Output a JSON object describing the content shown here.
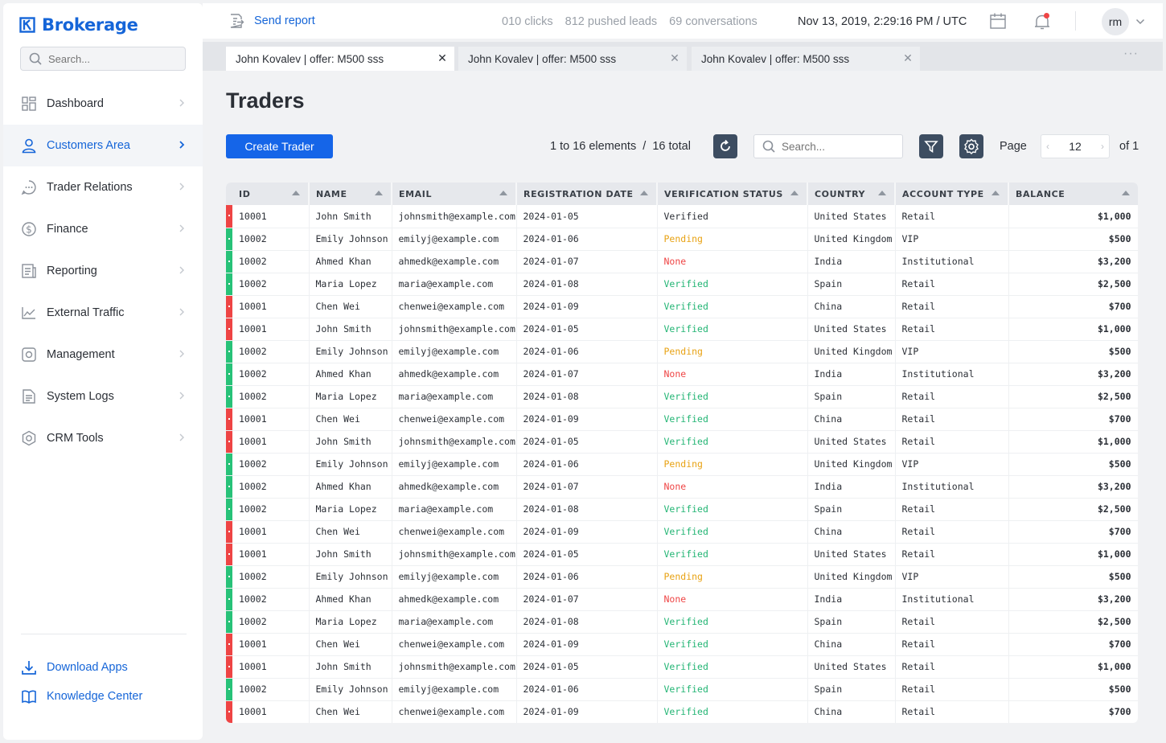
{
  "brand": {
    "name": "Brokerage"
  },
  "sidebar": {
    "search_placeholder": "Search...",
    "items": [
      {
        "label": "Dashboard",
        "icon": "dashboard-icon"
      },
      {
        "label": "Customers Area",
        "icon": "user-icon",
        "active": true
      },
      {
        "label": "Trader Relations",
        "icon": "chat-icon"
      },
      {
        "label": "Finance",
        "icon": "dollar-icon"
      },
      {
        "label": "Reporting",
        "icon": "report-icon"
      },
      {
        "label": "External Traffic",
        "icon": "chart-line-icon"
      },
      {
        "label": "Management",
        "icon": "gear-icon"
      },
      {
        "label": "System Logs",
        "icon": "document-icon"
      },
      {
        "label": "CRM Tools",
        "icon": "cog-icon"
      }
    ],
    "download_apps": "Download Apps",
    "knowledge_center": "Knowledge Center"
  },
  "header": {
    "send_report": "Send report",
    "clicks": "010 clicks",
    "pushed_leads": "812 pushed leads",
    "conversations": "69 conversations",
    "datetime": "Nov 13, 2019, 2:29:16 PM / UTC",
    "avatar_initials": "rm"
  },
  "tabs": [
    {
      "label": "John Kovalev | offer: M500 sss"
    },
    {
      "label": "John Kovalev | offer: M500 sss"
    },
    {
      "label": "John Kovalev | offer: M500 sss"
    }
  ],
  "page": {
    "title": "Traders",
    "create_button": "Create Trader",
    "elements_info": "1 to 16 elements  /  16 total",
    "search_placeholder": "Search...",
    "page_label": "Page",
    "page_number": "12",
    "of_label": "of 1"
  },
  "colors": {
    "accent": "#1565d8",
    "verified": "#23b574",
    "pending": "#e8a213",
    "none": "#ef4545",
    "indicator_red": "#ee4444",
    "indicator_green": "#27c278"
  },
  "table": {
    "columns": [
      "ID",
      "NAME",
      "EMAIL",
      "REGISTRATION DATE",
      "VERIFICATION STATUS",
      "COUNTRY",
      "ACCOUNT TYPE",
      "BALANCE"
    ],
    "rows": [
      {
        "ind": "red",
        "id": "10001",
        "name": "John Smith",
        "email": "johnsmith@example.com",
        "date": "2024-01-05",
        "status": "Verified",
        "status_class": "st-verified-plain",
        "country": "United States",
        "type": "Retail",
        "balance": "$1,000"
      },
      {
        "ind": "green",
        "id": "10002",
        "name": "Emily Johnson",
        "email": "emilyj@example.com",
        "date": "2024-01-06",
        "status": "Pending",
        "status_class": "st-pending",
        "country": "United Kingdom",
        "type": "VIP",
        "balance": "$500"
      },
      {
        "ind": "green",
        "id": "10002",
        "name": "Ahmed Khan",
        "email": "ahmedk@example.com",
        "date": "2024-01-07",
        "status": "None",
        "status_class": "st-none",
        "country": "India",
        "type": "Institutional",
        "balance": "$3,200"
      },
      {
        "ind": "green",
        "id": "10002",
        "name": "Maria Lopez",
        "email": "maria@example.com",
        "date": "2024-01-08",
        "status": "Verified",
        "status_class": "st-verified",
        "country": "Spain",
        "type": "Retail",
        "balance": "$2,500"
      },
      {
        "ind": "red",
        "id": "10001",
        "name": "Chen Wei",
        "email": "chenwei@example.com",
        "date": "2024-01-09",
        "status": "Verified",
        "status_class": "st-verified",
        "country": "China",
        "type": "Retail",
        "balance": "$700"
      },
      {
        "ind": "red",
        "id": "10001",
        "name": "John Smith",
        "email": "johnsmith@example.com",
        "date": "2024-01-05",
        "status": "Verified",
        "status_class": "st-verified",
        "country": "United States",
        "type": "Retail",
        "balance": "$1,000"
      },
      {
        "ind": "green",
        "id": "10002",
        "name": "Emily Johnson",
        "email": "emilyj@example.com",
        "date": "2024-01-06",
        "status": "Pending",
        "status_class": "st-pending",
        "country": "United Kingdom",
        "type": "VIP",
        "balance": "$500"
      },
      {
        "ind": "green",
        "id": "10002",
        "name": "Ahmed Khan",
        "email": "ahmedk@example.com",
        "date": "2024-01-07",
        "status": "None",
        "status_class": "st-none",
        "country": "India",
        "type": "Institutional",
        "balance": "$3,200"
      },
      {
        "ind": "green",
        "id": "10002",
        "name": "Maria Lopez",
        "email": "maria@example.com",
        "date": "2024-01-08",
        "status": "Verified",
        "status_class": "st-verified",
        "country": "Spain",
        "type": "Retail",
        "balance": "$2,500"
      },
      {
        "ind": "red",
        "id": "10001",
        "name": "Chen Wei",
        "email": "chenwei@example.com",
        "date": "2024-01-09",
        "status": "Verified",
        "status_class": "st-verified",
        "country": "China",
        "type": "Retail",
        "balance": "$700"
      },
      {
        "ind": "red",
        "id": "10001",
        "name": "John Smith",
        "email": "johnsmith@example.com",
        "date": "2024-01-05",
        "status": "Verified",
        "status_class": "st-verified",
        "country": "United States",
        "type": "Retail",
        "balance": "$1,000"
      },
      {
        "ind": "green",
        "id": "10002",
        "name": "Emily Johnson",
        "email": "emilyj@example.com",
        "date": "2024-01-06",
        "status": "Pending",
        "status_class": "st-pending",
        "country": "United Kingdom",
        "type": "VIP",
        "balance": "$500"
      },
      {
        "ind": "green",
        "id": "10002",
        "name": "Ahmed Khan",
        "email": "ahmedk@example.com",
        "date": "2024-01-07",
        "status": "None",
        "status_class": "st-none",
        "country": "India",
        "type": "Institutional",
        "balance": "$3,200"
      },
      {
        "ind": "green",
        "id": "10002",
        "name": "Maria Lopez",
        "email": "maria@example.com",
        "date": "2024-01-08",
        "status": "Verified",
        "status_class": "st-verified",
        "country": "Spain",
        "type": "Retail",
        "balance": "$2,500"
      },
      {
        "ind": "red",
        "id": "10001",
        "name": "Chen Wei",
        "email": "chenwei@example.com",
        "date": "2024-01-09",
        "status": "Verified",
        "status_class": "st-verified",
        "country": "China",
        "type": "Retail",
        "balance": "$700"
      },
      {
        "ind": "red",
        "id": "10001",
        "name": "John Smith",
        "email": "johnsmith@example.com",
        "date": "2024-01-05",
        "status": "Verified",
        "status_class": "st-verified",
        "country": "United States",
        "type": "Retail",
        "balance": "$1,000"
      },
      {
        "ind": "green",
        "id": "10002",
        "name": "Emily Johnson",
        "email": "emilyj@example.com",
        "date": "2024-01-06",
        "status": "Pending",
        "status_class": "st-pending",
        "country": "United Kingdom",
        "type": "VIP",
        "balance": "$500"
      },
      {
        "ind": "green",
        "id": "10002",
        "name": "Ahmed Khan",
        "email": "ahmedk@example.com",
        "date": "2024-01-07",
        "status": "None",
        "status_class": "st-none",
        "country": "India",
        "type": "Institutional",
        "balance": "$3,200"
      },
      {
        "ind": "green",
        "id": "10002",
        "name": "Maria Lopez",
        "email": "maria@example.com",
        "date": "2024-01-08",
        "status": "Verified",
        "status_class": "st-verified",
        "country": "Spain",
        "type": "Retail",
        "balance": "$2,500"
      },
      {
        "ind": "red",
        "id": "10001",
        "name": "Chen Wei",
        "email": "chenwei@example.com",
        "date": "2024-01-09",
        "status": "Verified",
        "status_class": "st-verified",
        "country": "China",
        "type": "Retail",
        "balance": "$700"
      },
      {
        "ind": "red",
        "id": "10001",
        "name": "John Smith",
        "email": "johnsmith@example.com",
        "date": "2024-01-05",
        "status": "Verified",
        "status_class": "st-verified",
        "country": "United States",
        "type": "Retail",
        "balance": "$1,000"
      },
      {
        "ind": "green",
        "id": "10002",
        "name": "Emily Johnson",
        "email": "emilyj@example.com",
        "date": "2024-01-06",
        "status": "Verified",
        "status_class": "st-verified",
        "country": "Spain",
        "type": "Retail",
        "balance": "$500"
      },
      {
        "ind": "red",
        "id": "10001",
        "name": "Chen Wei",
        "email": "chenwei@example.com",
        "date": "2024-01-09",
        "status": "Verified",
        "status_class": "st-verified",
        "country": "China",
        "type": "Retail",
        "balance": "$700"
      }
    ]
  }
}
